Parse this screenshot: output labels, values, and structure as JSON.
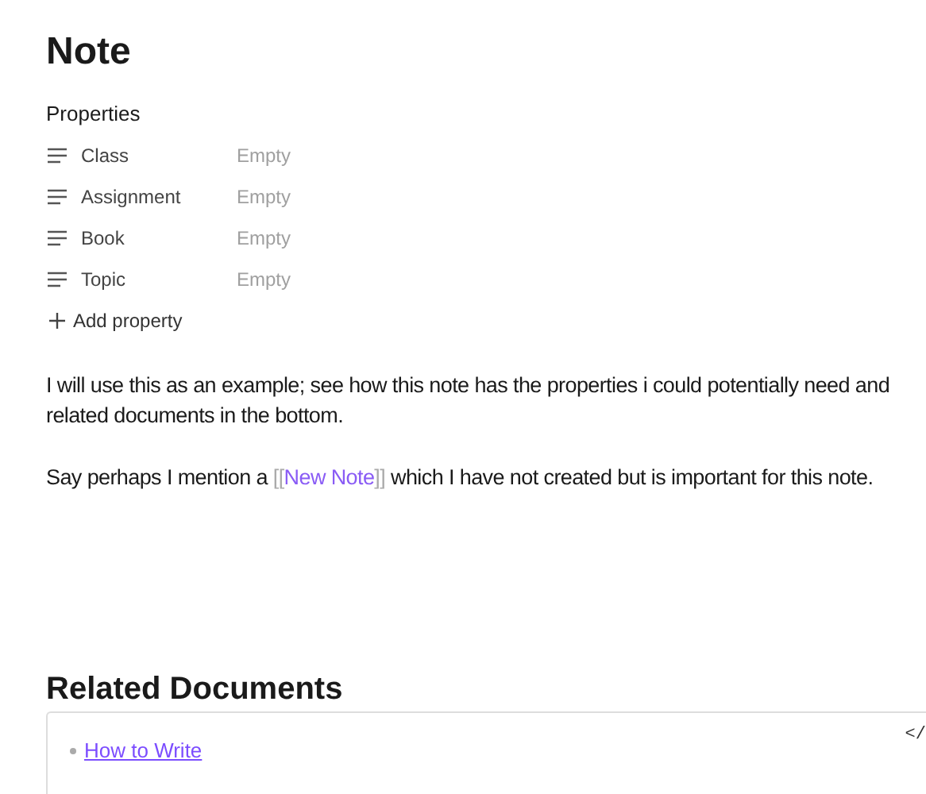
{
  "title": "Note",
  "properties": {
    "heading": "Properties",
    "items": [
      {
        "name": "Class",
        "value": "Empty"
      },
      {
        "name": "Assignment",
        "value": "Empty"
      },
      {
        "name": "Book",
        "value": "Empty"
      },
      {
        "name": "Topic",
        "value": "Empty"
      }
    ],
    "add_label": "Add property"
  },
  "paragraphs": [
    {
      "text": "I will use this as an example; see how this note has the properties i could potentially need and related documents in the bottom."
    },
    {
      "before": "Say perhaps I mention a ",
      "open": "[[",
      "link": "New Note",
      "close": "]]",
      "after": " which I have not created but is important for this note."
    }
  ],
  "related": {
    "heading": "Related Documents",
    "code_toggle": "</",
    "links": [
      "How to Write"
    ]
  }
}
